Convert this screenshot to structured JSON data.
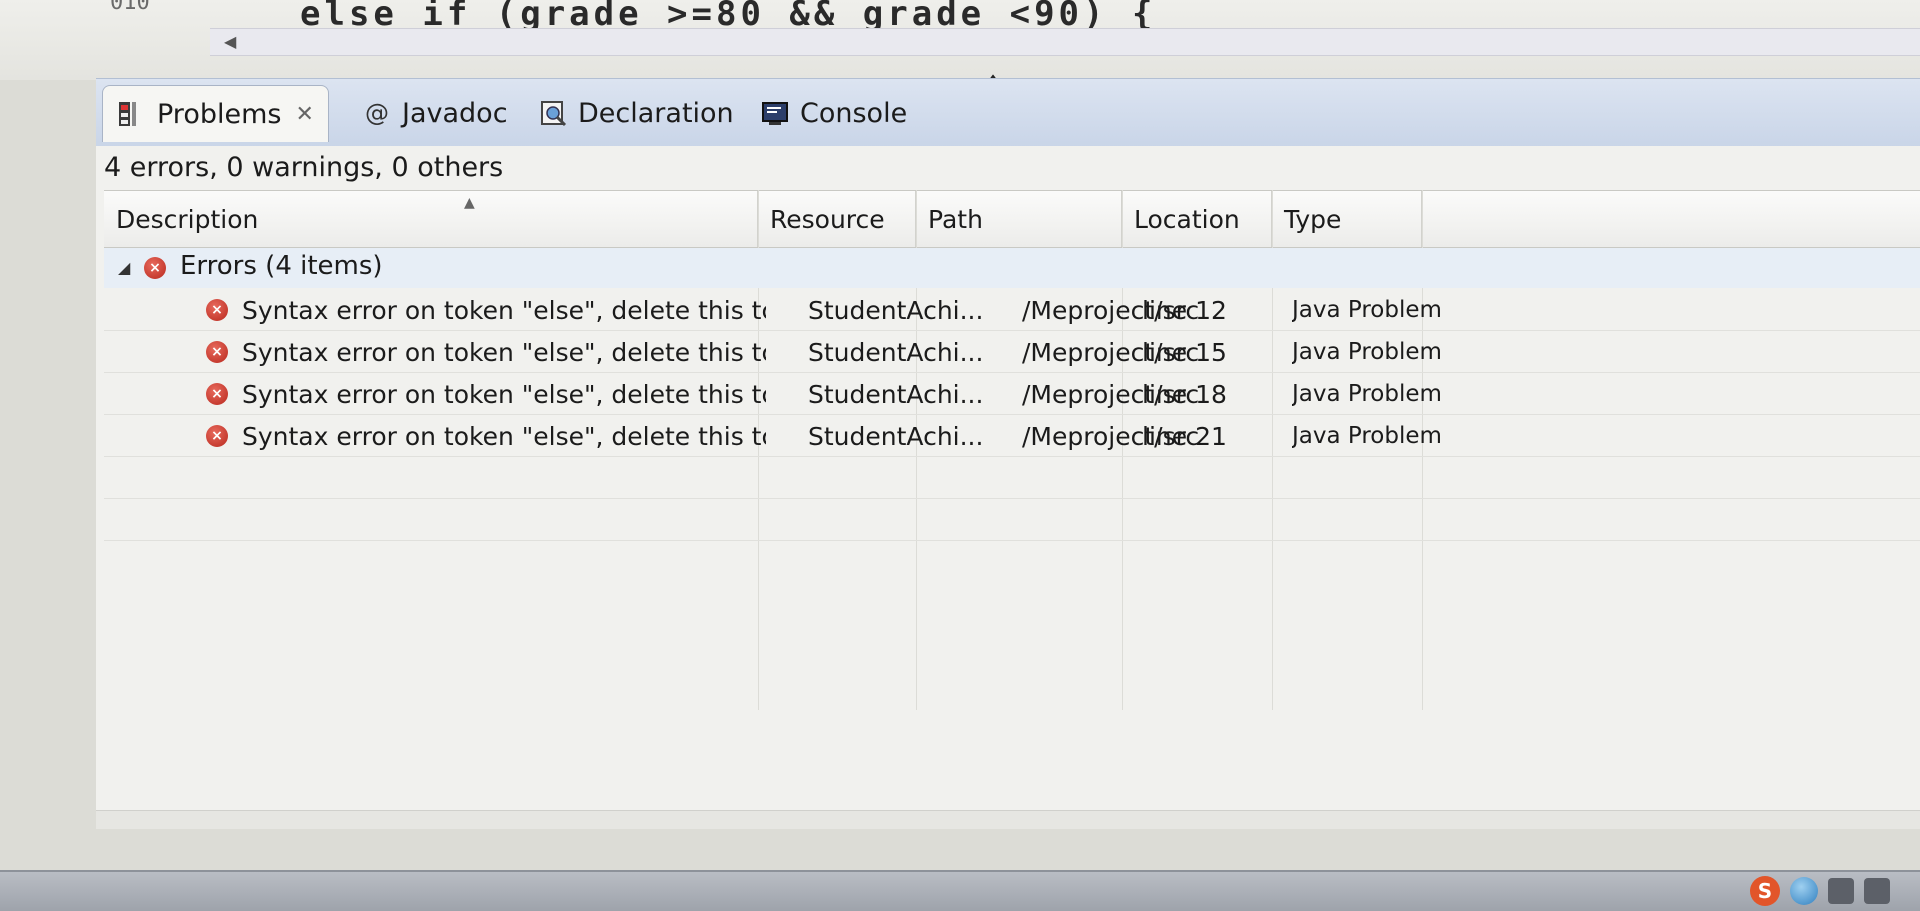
{
  "editor": {
    "code_fragment": "else if (grade >=80 && grade <90) {",
    "line_fragment": "010"
  },
  "tabs": [
    {
      "label": "Problems",
      "icon": "problems-icon",
      "active": true
    },
    {
      "label": "Javadoc",
      "icon": "javadoc-icon",
      "active": false
    },
    {
      "label": "Declaration",
      "icon": "declaration-icon",
      "active": false
    },
    {
      "label": "Console",
      "icon": "console-icon",
      "active": false
    }
  ],
  "problems": {
    "summary": "4 errors, 0 warnings, 0 others",
    "columns": [
      "Description",
      "Resource",
      "Path",
      "Location",
      "Type"
    ],
    "group": {
      "label": "Errors (4 items)",
      "icon": "error-icon"
    },
    "rows": [
      {
        "description": "Syntax error on token \"else\", delete this tc",
        "resource": "StudentAchi...",
        "path": "/Meproject/src",
        "location": "line 12",
        "type": "Java Problem"
      },
      {
        "description": "Syntax error on token \"else\", delete this tc",
        "resource": "StudentAchi...",
        "path": "/Meproject/src",
        "location": "line 15",
        "type": "Java Problem"
      },
      {
        "description": "Syntax error on token \"else\", delete this tc",
        "resource": "StudentAchi...",
        "path": "/Meproject/src",
        "location": "line 18",
        "type": "Java Problem"
      },
      {
        "description": "Syntax error on token \"else\", delete this tc",
        "resource": "StudentAchi...",
        "path": "/Meproject/src",
        "location": "line 21",
        "type": "Java Problem"
      }
    ]
  },
  "taskbar": {
    "tray_s_label": "S",
    "tray_icons": [
      "sogou-icon",
      "globe-icon",
      "volume-icon",
      "network-icon"
    ]
  },
  "colors": {
    "error_red": "#c0392b",
    "tabbar_blue": "#c9d5e8",
    "panel_bg": "#f1f1ee"
  }
}
